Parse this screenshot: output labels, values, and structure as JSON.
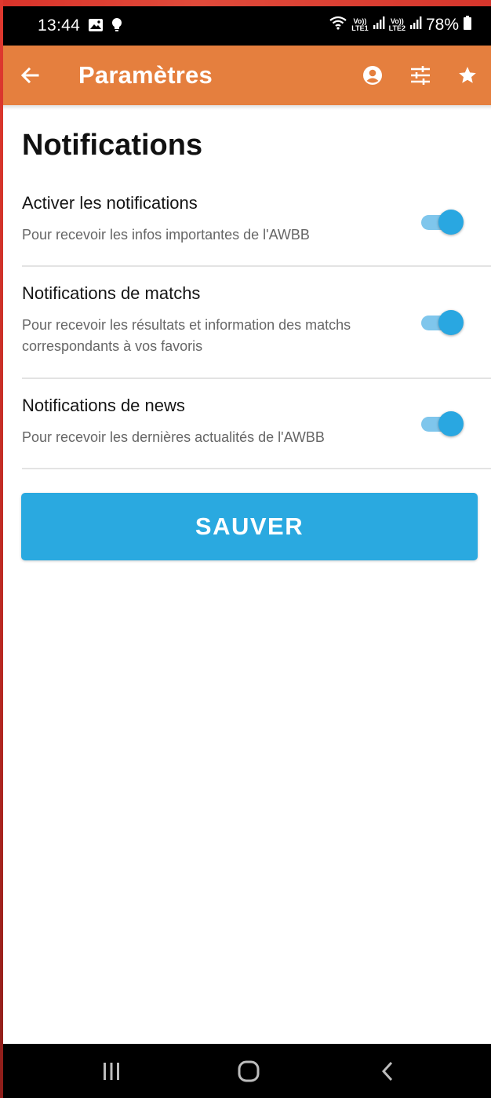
{
  "status_bar": {
    "time": "13:44",
    "net1": [
      "Vo))",
      "LTE1"
    ],
    "net2": [
      "Vo))",
      "LTE2"
    ],
    "battery": "78%",
    "icons": [
      "image-icon",
      "bulb-icon",
      "wifi-icon",
      "signal-icon",
      "battery-icon"
    ]
  },
  "app_bar": {
    "title": "Paramètres",
    "icons": [
      "back-arrow-icon",
      "account-icon",
      "sliders-icon",
      "star-icon"
    ],
    "background_color": "#e57f3e"
  },
  "main": {
    "section_title": "Notifications",
    "settings": [
      {
        "title": "Activer les notifications",
        "description": "Pour recevoir les infos importantes de l'AWBB",
        "enabled": true
      },
      {
        "title": "Notifications de matchs",
        "description": "Pour recevoir les résultats et information des matchs correspondants à vos favoris",
        "enabled": true
      },
      {
        "title": "Notifications de news",
        "description": "Pour recevoir les dernières actualités de l'AWBB",
        "enabled": true
      }
    ],
    "save_label": "SAUVER",
    "accent_color": "#29a7e1"
  },
  "nav_bar": {
    "icons": [
      "recent-apps-icon",
      "home-icon",
      "back-icon"
    ]
  }
}
